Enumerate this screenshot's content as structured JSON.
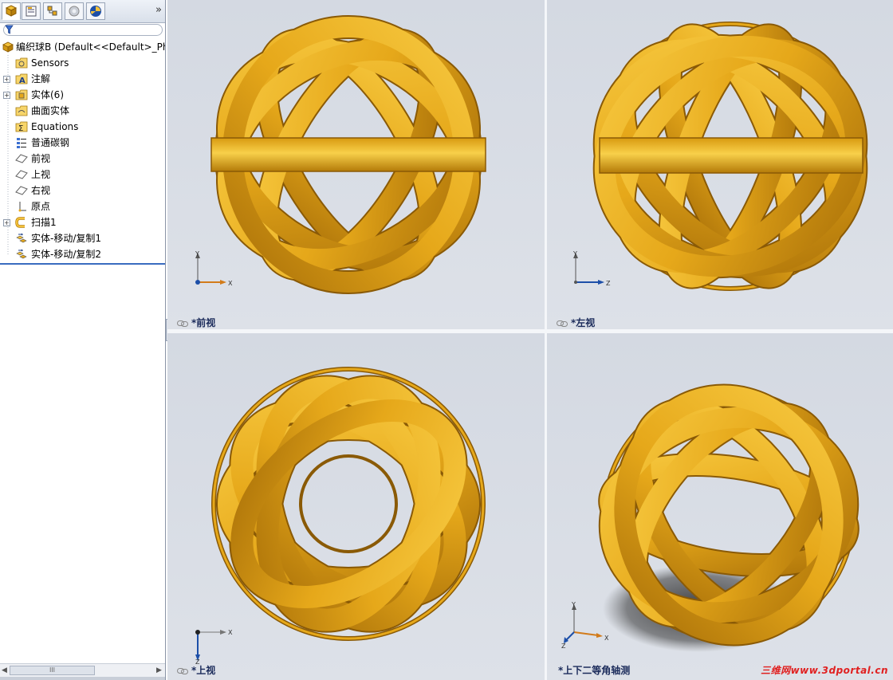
{
  "left_panel": {
    "tabs": [
      {
        "name": "feature-manager-tab",
        "icon": "feature-tree-icon"
      },
      {
        "name": "property-manager-tab",
        "icon": "property-icon"
      },
      {
        "name": "configuration-manager-tab",
        "icon": "configuration-icon"
      },
      {
        "name": "dim-xpert-tab",
        "icon": "dimxpert-icon"
      },
      {
        "name": "display-manager-tab",
        "icon": "display-icon"
      }
    ],
    "more_label": "»",
    "tree": [
      {
        "label": "编织球B  (Default<<Default>_Ph",
        "icon": "part-icon",
        "level": 0,
        "expander": ""
      },
      {
        "label": "Sensors",
        "icon": "sensors-folder-icon",
        "level": 1,
        "expander": ""
      },
      {
        "label": "注解",
        "icon": "annotations-icon",
        "level": 1,
        "expander": "+"
      },
      {
        "label": "实体(6)",
        "icon": "solid-bodies-folder-icon",
        "level": 1,
        "expander": "+"
      },
      {
        "label": "曲面实体",
        "icon": "surface-bodies-folder-icon",
        "level": 1,
        "expander": ""
      },
      {
        "label": "Equations",
        "icon": "equations-icon",
        "level": 1,
        "expander": ""
      },
      {
        "label": "普通碳钢",
        "icon": "material-icon",
        "level": 1,
        "expander": ""
      },
      {
        "label": "前视",
        "icon": "plane-icon",
        "level": 1,
        "expander": ""
      },
      {
        "label": "上视",
        "icon": "plane-icon",
        "level": 1,
        "expander": ""
      },
      {
        "label": "右视",
        "icon": "plane-icon",
        "level": 1,
        "expander": ""
      },
      {
        "label": "原点",
        "icon": "origin-icon",
        "level": 1,
        "expander": ""
      },
      {
        "label": "扫描1",
        "icon": "sweep-icon",
        "level": 1,
        "expander": "+"
      },
      {
        "label": "实体-移动/复制1",
        "icon": "move-copy-icon",
        "level": 1,
        "expander": ""
      },
      {
        "label": "实体-移动/复制2",
        "icon": "move-copy-icon",
        "level": 1,
        "expander": ""
      }
    ],
    "scroll_thumb": "III"
  },
  "viewports": {
    "front": {
      "label": "*前视",
      "axes": [
        "Y",
        "X"
      ]
    },
    "left": {
      "label": "*左视",
      "axes": [
        "Y",
        "Z"
      ]
    },
    "top": {
      "label": "*上视",
      "axes": [
        "X",
        "Z"
      ]
    },
    "iso": {
      "label": "*上下二等角轴测",
      "axes": [
        "Y",
        "X",
        "Z"
      ]
    }
  },
  "watermark": "三维网www.3dportal.cn",
  "colors": {
    "model_gold": "#e6a81a",
    "model_dark": "#8a5a06",
    "viewport_bg": "#d6dbe4",
    "label_color": "#1a2a5a"
  }
}
